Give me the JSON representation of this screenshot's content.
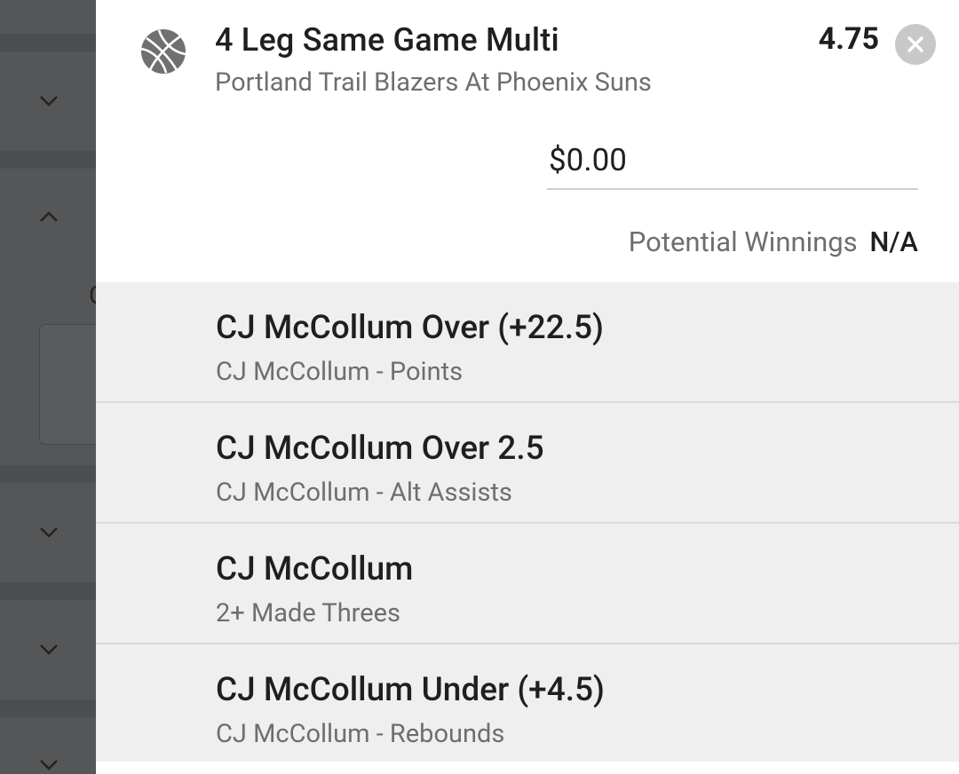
{
  "background": {
    "chevrons": [
      "chevron-down-icon",
      "chevron-up-icon",
      "chevron-down-icon",
      "chevron-down-icon",
      "chevron-down-icon"
    ],
    "partial_text": "C"
  },
  "bet": {
    "sport_icon": "basketball-icon",
    "title": "4 Leg Same Game Multi",
    "subtitle": "Portland Trail Blazers At Phoenix Suns",
    "odds": "4.75",
    "close_icon": "close-icon",
    "stake_value": "$0.00",
    "winnings_label": "Potential Winnings",
    "winnings_value": "N/A"
  },
  "legs": [
    {
      "title": "CJ McCollum Over (+22.5)",
      "subtitle": "CJ McCollum - Points"
    },
    {
      "title": "CJ McCollum Over 2.5",
      "subtitle": "CJ McCollum - Alt Assists"
    },
    {
      "title": "CJ McCollum",
      "subtitle": "2+ Made Threes"
    },
    {
      "title": "CJ McCollum Under (+4.5)",
      "subtitle": "CJ McCollum - Rebounds"
    }
  ],
  "colors": {
    "overlay": "#555657",
    "legs_bg": "#efefef",
    "close_bg": "#c8c8c8"
  }
}
